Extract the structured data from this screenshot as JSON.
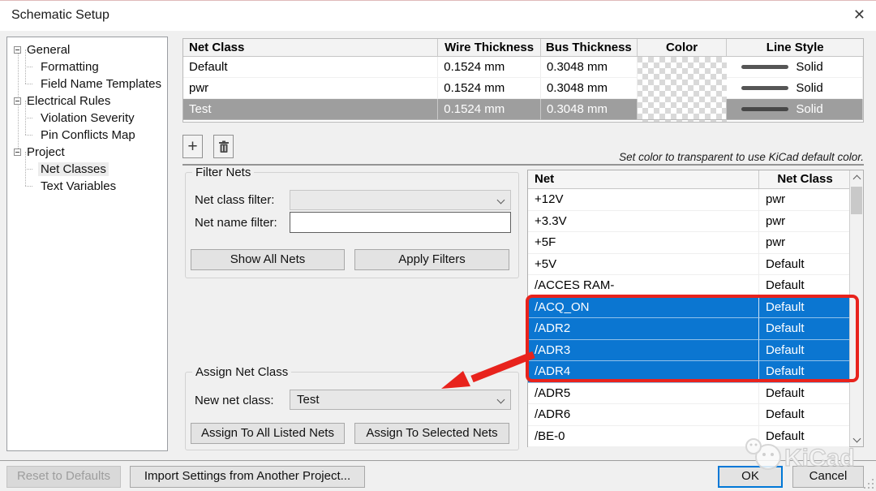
{
  "window": {
    "title": "Schematic Setup"
  },
  "icons": {
    "close": "✕",
    "add": "+",
    "delete": "trash-icon",
    "dropdown": "chevron-down",
    "scroll_up": "chevron-up",
    "scroll_down": "chevron-down"
  },
  "colors": {
    "selection_blue": "#0b76d1",
    "selection_gray": "#9e9e9e",
    "annotation_red": "#e8231d",
    "focus_blue": "#0078d7"
  },
  "sidebar": {
    "items": [
      {
        "label": "General",
        "level": 0,
        "selected": false
      },
      {
        "label": "Formatting",
        "level": 1,
        "selected": false
      },
      {
        "label": "Field Name Templates",
        "level": 1,
        "selected": false
      },
      {
        "label": "Electrical Rules",
        "level": 0,
        "selected": false
      },
      {
        "label": "Violation Severity",
        "level": 1,
        "selected": false
      },
      {
        "label": "Pin Conflicts Map",
        "level": 1,
        "selected": false
      },
      {
        "label": "Project",
        "level": 0,
        "selected": false
      },
      {
        "label": "Net Classes",
        "level": 1,
        "selected": true
      },
      {
        "label": "Text Variables",
        "level": 1,
        "selected": false
      }
    ]
  },
  "net_class_table": {
    "headers": [
      "Net Class",
      "Wire Thickness",
      "Bus Thickness",
      "Color",
      "Line Style"
    ],
    "rows": [
      {
        "name": "Default",
        "wire": "0.1524 mm",
        "bus": "0.3048 mm",
        "color": "transparent",
        "line_style": "Solid",
        "selected": false
      },
      {
        "name": "pwr",
        "wire": "0.1524 mm",
        "bus": "0.3048 mm",
        "color": "transparent",
        "line_style": "Solid",
        "selected": false
      },
      {
        "name": "Test",
        "wire": "0.1524 mm",
        "bus": "0.3048 mm",
        "color": "transparent",
        "line_style": "Solid",
        "selected": true
      }
    ],
    "hint": "Set color to transparent to use KiCad default color."
  },
  "filter_nets": {
    "title": "Filter Nets",
    "net_class_filter_label": "Net class filter:",
    "net_class_filter_value": "",
    "net_name_filter_label": "Net name filter:",
    "net_name_filter_value": "",
    "show_all_label": "Show All Nets",
    "apply_label": "Apply Filters"
  },
  "assign": {
    "title": "Assign Net Class",
    "new_net_class_label": "New net class:",
    "new_net_class_value": "Test",
    "assign_all_label": "Assign To All Listed Nets",
    "assign_selected_label": "Assign To Selected Nets"
  },
  "net_table": {
    "headers": [
      "Net",
      "Net Class"
    ],
    "rows": [
      {
        "net": "+12V",
        "class": "pwr",
        "selected": false
      },
      {
        "net": "+3.3V",
        "class": "pwr",
        "selected": false
      },
      {
        "net": "+5F",
        "class": "pwr",
        "selected": false
      },
      {
        "net": "+5V",
        "class": "Default",
        "selected": false
      },
      {
        "net": "/ACCES RAM-",
        "class": "Default",
        "selected": false
      },
      {
        "net": "/ACQ_ON",
        "class": "Default",
        "selected": true
      },
      {
        "net": "/ADR2",
        "class": "Default",
        "selected": true
      },
      {
        "net": "/ADR3",
        "class": "Default",
        "selected": true
      },
      {
        "net": "/ADR4",
        "class": "Default",
        "selected": true
      },
      {
        "net": "/ADR5",
        "class": "Default",
        "selected": false
      },
      {
        "net": "/ADR6",
        "class": "Default",
        "selected": false
      },
      {
        "net": "/BE-0",
        "class": "Default",
        "selected": false
      }
    ]
  },
  "footer": {
    "reset_label": "Reset to Defaults",
    "import_label": "Import Settings from Another Project...",
    "ok_label": "OK",
    "cancel_label": "Cancel"
  },
  "watermark": {
    "text": "KiCad"
  }
}
